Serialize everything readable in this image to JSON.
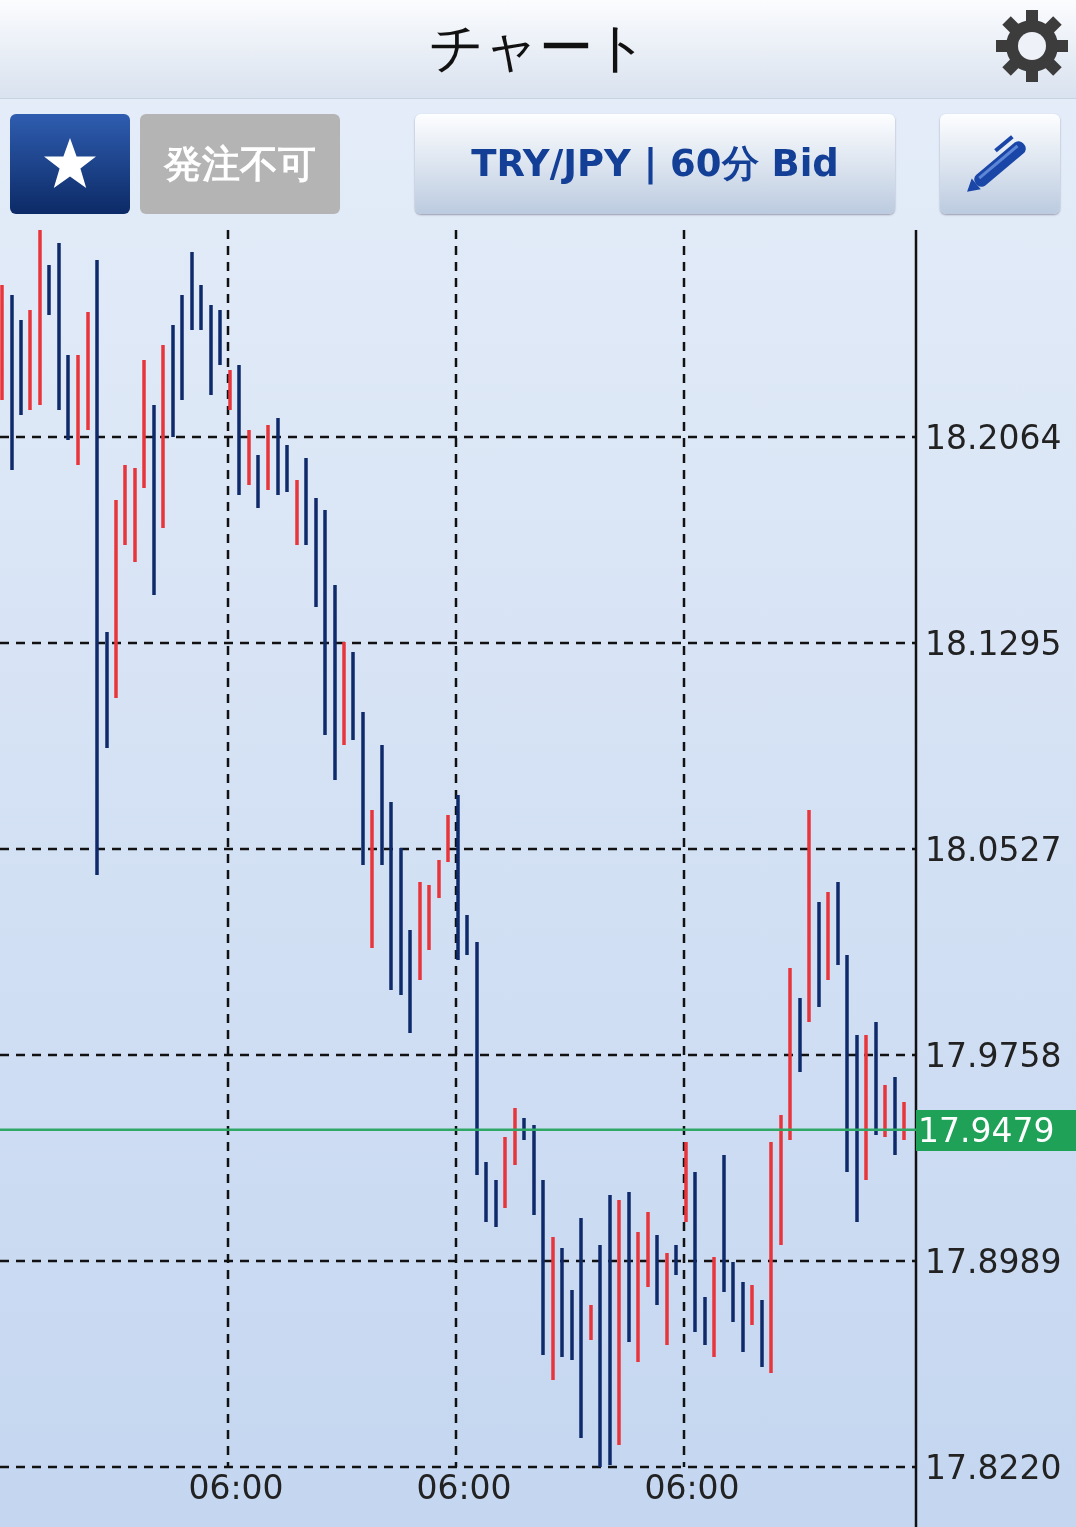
{
  "header": {
    "title": "チャート"
  },
  "toolbar": {
    "order_button": {
      "label": "発注不可",
      "disabled": true
    },
    "symbol_button": {
      "label": "TRY/JPY | 60分 Bid"
    }
  },
  "chart": {
    "y_labels": [
      "18.2064",
      "18.1295",
      "18.0527",
      "17.9758",
      "17.8989",
      "17.8220"
    ],
    "x_labels": [
      "06:00",
      "06:00",
      "06:00"
    ],
    "current_price": {
      "label": "17.9479"
    }
  }
}
